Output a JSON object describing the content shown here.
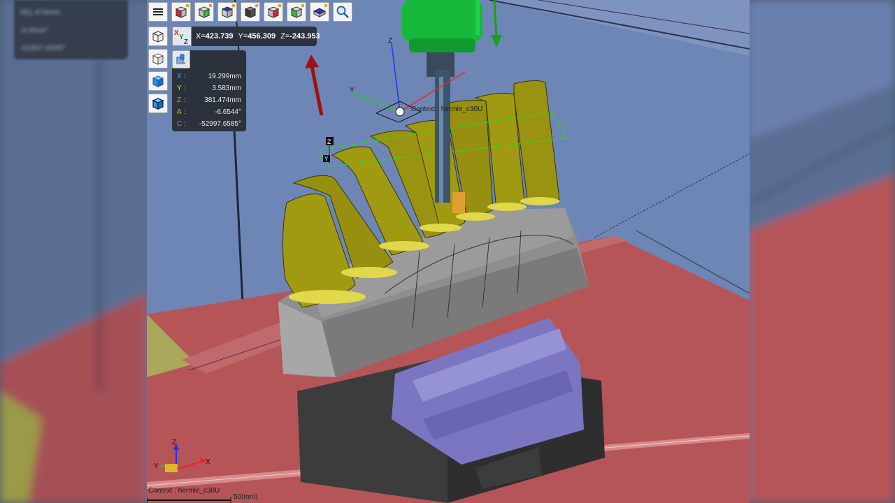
{
  "background_panel": {
    "rows": [
      "381.474mm",
      "-6.6544°",
      "-52997.6585°"
    ]
  },
  "toolbar": {
    "buttons": [
      {
        "name": "menu",
        "icon": "hamburger-icon"
      },
      {
        "name": "view-front",
        "icon": "cube-red-face-icon",
        "face_color": "#d72b2b"
      },
      {
        "name": "view-left",
        "icon": "cube-green-face-icon",
        "face_color": "#2fbf2f"
      },
      {
        "name": "view-top",
        "icon": "cube-blue-face-icon",
        "face_color": "#2535cf"
      },
      {
        "name": "view-iso-custom",
        "icon": "cube-dark-icon",
        "face_color": "#3a3a3a"
      },
      {
        "name": "view-right",
        "icon": "cube-red-side-icon",
        "face_color": "#d72b2b"
      },
      {
        "name": "view-back",
        "icon": "cube-green-side-icon",
        "face_color": "#2fbf2f"
      },
      {
        "name": "view-bottom",
        "icon": "cube-blue-bottom-icon",
        "face_color": "#2535cf"
      },
      {
        "name": "zoom-fit",
        "icon": "magnifier-icon"
      }
    ]
  },
  "coordinates": {
    "x_label": "X=",
    "x_value": "423.739",
    "y_label": "Y=",
    "y_value": "456.309",
    "z_label": "Z=",
    "z_value": "-243.953"
  },
  "readout": {
    "rows": [
      {
        "label": "X",
        "value": "19.299mm",
        "color": "#4aa3ff"
      },
      {
        "label": "Y",
        "value": "3.583mm",
        "color": "#e0e040"
      },
      {
        "label": "Z",
        "value": "381.474mm",
        "color": "#3fd13f"
      },
      {
        "label": "A",
        "value": "-6.6544°",
        "color": "#e8b040"
      },
      {
        "label": "C",
        "value": "-52997.6585°",
        "color": "#e07070"
      }
    ]
  },
  "scene": {
    "context_label_3d": "Context : hermle_c30U",
    "tool_z_label": "Z",
    "tool_y_label": "Y",
    "gizmo_z": "Z",
    "gizmo_y": "Y",
    "gizmo_x": "X"
  },
  "status": {
    "context": "Context : hermle_c30U",
    "scale": "50(mm)"
  },
  "colors": {
    "viewport_bg": "#6e86b5",
    "floor": "#b55558",
    "part": "#a09a12",
    "fixture": "#8a8a8a",
    "vise": "#7a76c2",
    "base": "#3c3c3c",
    "spindle": "#17b93a"
  }
}
